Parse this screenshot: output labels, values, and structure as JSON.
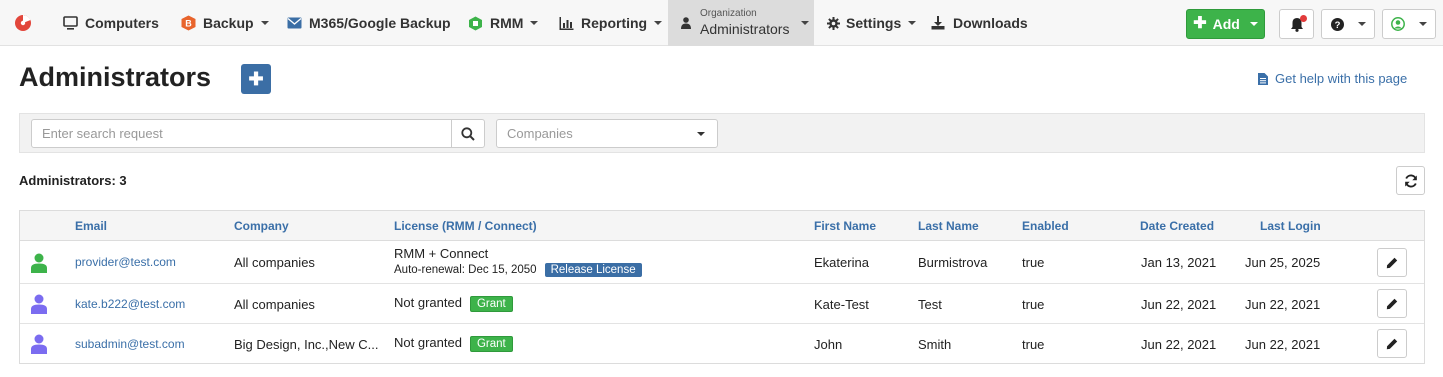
{
  "nav": {
    "items": [
      {
        "label": "Computers",
        "icon": "monitor-icon"
      },
      {
        "label": "Backup",
        "icon": "backup-icon"
      },
      {
        "label": "M365/Google Backup",
        "icon": "envelope-icon"
      },
      {
        "label": "RMM",
        "icon": "rmm-icon"
      },
      {
        "label": "Reporting",
        "icon": "bar-chart-icon"
      },
      {
        "label": "Settings",
        "icon": "gear-icon"
      },
      {
        "label": "Downloads",
        "icon": "download-icon"
      }
    ],
    "org_small": "Organization",
    "org_big": "Administrators",
    "add_label": "Add"
  },
  "page": {
    "title": "Administrators",
    "help_link": "Get help with this page"
  },
  "filters": {
    "search_placeholder": "Enter search request",
    "companies_placeholder": "Companies"
  },
  "count_label": "Administrators: 3",
  "table": {
    "headers": [
      "Email",
      "Company",
      "License (RMM / Connect)",
      "First Name",
      "Last Name",
      "Enabled",
      "Date Created",
      "Last Login"
    ],
    "rows": [
      {
        "email": "provider@test.com",
        "company": "All companies",
        "license": "RMM + Connect",
        "license_sub": "Auto-renewal:  Dec 15, 2050",
        "license_action": "Release License",
        "first_name": "Ekaterina",
        "last_name": "Burmistrova",
        "enabled": "true",
        "date_created": "Jan 13, 2021",
        "last_login": "Jun 25, 2025"
      },
      {
        "email": "kate.b222@test.com",
        "company": "All companies",
        "license": "Not granted",
        "license_action": "Grant",
        "first_name": "Kate-Test",
        "last_name": "Test",
        "enabled": "true",
        "date_created": "Jun 22, 2021",
        "last_login": "Jun 22, 2021"
      },
      {
        "email": "subadmin@test.com",
        "company": "Big Design, Inc.,New C...",
        "license": "Not granted",
        "license_action": "Grant",
        "first_name": "John",
        "last_name": "Smith",
        "enabled": "true",
        "date_created": "Jun 22, 2021",
        "last_login": "Jun 22, 2021"
      }
    ]
  },
  "colors": {
    "accent_blue": "#3b6ea5",
    "link_blue": "#3a6fa8",
    "green": "#3db34a",
    "logo_red": "#e2463b",
    "user_green": "#3db34a",
    "user_purple": "#7b6cf0"
  }
}
